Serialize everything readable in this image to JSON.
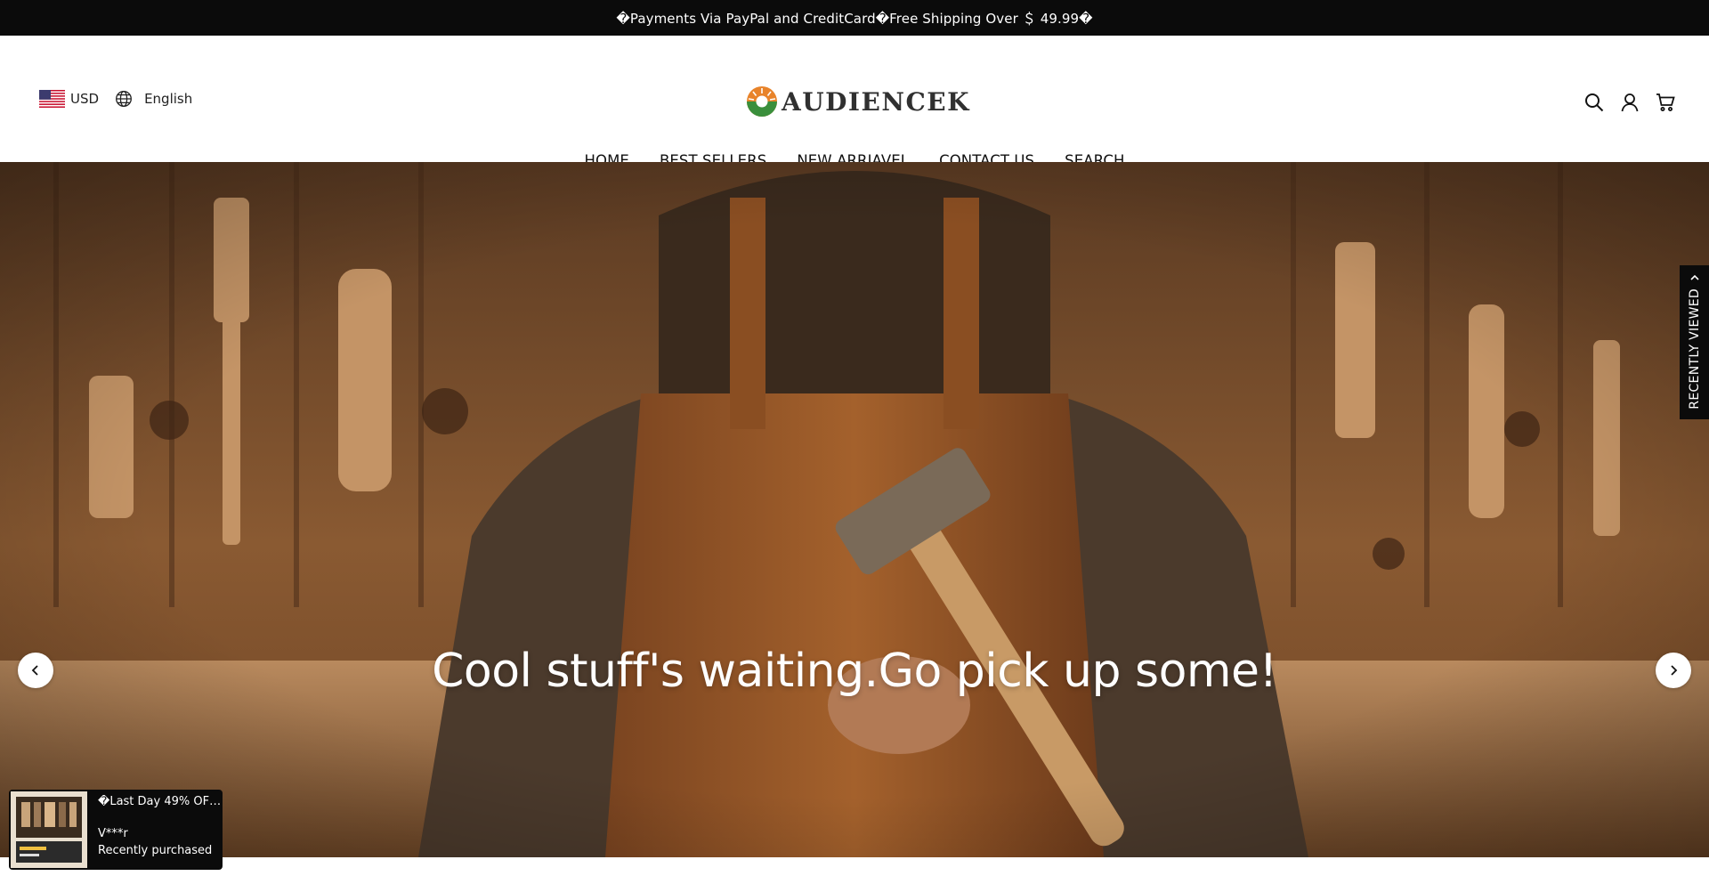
{
  "announcement": {
    "text": "�Payments Via PayPal and CreditCard�Free Shipping Over ＄ 49.99�"
  },
  "header": {
    "currency": "USD",
    "currency_flag": "us-flag-icon",
    "language": "English",
    "language_icon": "globe-icon",
    "logo_text": "AUDIENCEK",
    "icons": [
      "search-icon",
      "account-icon",
      "cart-icon"
    ]
  },
  "nav": {
    "items": [
      {
        "label": "HOME"
      },
      {
        "label": "BEST SELLERS"
      },
      {
        "label": "NEW ARRIAVEL"
      },
      {
        "label": "CONTACT US"
      },
      {
        "label": "SEARCH"
      }
    ]
  },
  "hero": {
    "title": "Cool stuff's waiting.Go pick up some!",
    "prev_icon": "chevron-left-icon",
    "next_icon": "chevron-right-icon"
  },
  "recently_viewed": {
    "label": "RECENTLY VIEWED",
    "icon": "chevron-up-icon"
  },
  "purchase_popup": {
    "title": "�Last Day 49% OFF ...",
    "buyer": "V***r",
    "status": "Recently purchased"
  },
  "colors": {
    "announcement_bg": "#0b0b0b",
    "text": "#111111",
    "hero_brown": "#8a5a32",
    "logo_orange": "#e8832a",
    "logo_green": "#3a8f3c"
  }
}
